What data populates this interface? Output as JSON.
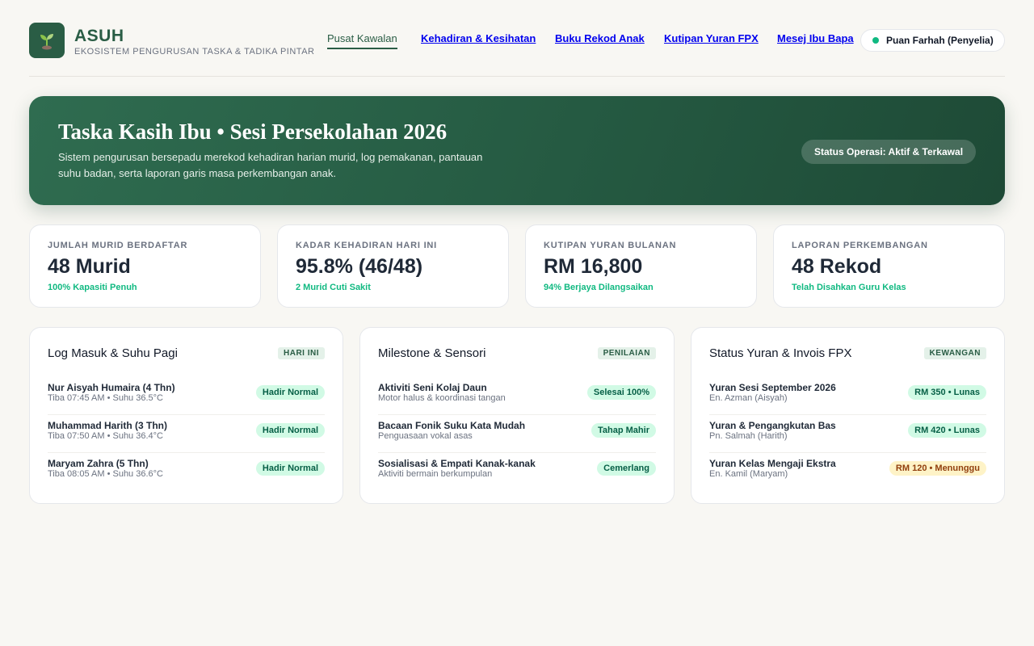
{
  "brand": {
    "name": "ASUH",
    "subtitle": "EKOSISTEM PENGURUSAN TASKA & TADIKA PINTAR",
    "icon": "sprout-icon",
    "color": "#2a5d45"
  },
  "nav": {
    "items": [
      {
        "label": "Pusat Kawalan",
        "active": true
      },
      {
        "label": "Kehadiran & Kesihatan",
        "active": false
      },
      {
        "label": "Buku Rekod Anak",
        "active": false
      },
      {
        "label": "Kutipan Yuran FPX",
        "active": false
      },
      {
        "label": "Mesej Ibu Bapa",
        "active": false
      }
    ]
  },
  "user": {
    "name": "Puan Farhah (Penyelia)",
    "status_color": "#10b981"
  },
  "hero": {
    "title": "Taska Kasih Ibu • Sesi Persekolahan 2026",
    "description": "Sistem pengurusan bersepadu merekod kehadiran harian murid, log pemakanan, pantauan suhu badan, serta laporan garis masa perkembangan anak.",
    "status": "Status Operasi: Aktif & Terkawal"
  },
  "stats": [
    {
      "label": "JUMLAH MURID BERDAFTAR",
      "value": "48 Murid",
      "note": "100% Kapasiti Penuh"
    },
    {
      "label": "KADAR KEHADIRAN HARI INI",
      "value": "95.8% (46/48)",
      "note": "2 Murid Cuti Sakit"
    },
    {
      "label": "KUTIPAN YURAN BULANAN",
      "value": "RM 16,800",
      "note": "94% Berjaya Dilangsaikan"
    },
    {
      "label": "LAPORAN PERKEMBANGAN",
      "value": "48 Rekod",
      "note": "Telah Disahkan Guru Kelas"
    }
  ],
  "panels": [
    {
      "title": "Log Masuk & Suhu Pagi",
      "tag": "HARI INI",
      "rows": [
        {
          "title": "Nur Aisyah Humaira (4 Thn)",
          "sub": "Tiba 07:45 AM • Suhu 36.5°C",
          "badge": "Hadir Normal",
          "status": "ok"
        },
        {
          "title": "Muhammad Harith (3 Thn)",
          "sub": "Tiba 07:50 AM • Suhu 36.4°C",
          "badge": "Hadir Normal",
          "status": "ok"
        },
        {
          "title": "Maryam Zahra (5 Thn)",
          "sub": "Tiba 08:05 AM • Suhu 36.6°C",
          "badge": "Hadir Normal",
          "status": "ok"
        }
      ]
    },
    {
      "title": "Milestone & Sensori",
      "tag": "PENILAIAN",
      "rows": [
        {
          "title": "Aktiviti Seni Kolaj Daun",
          "sub": "Motor halus & koordinasi tangan",
          "badge": "Selesai 100%",
          "status": "ok"
        },
        {
          "title": "Bacaan Fonik Suku Kata Mudah",
          "sub": "Penguasaan vokal asas",
          "badge": "Tahap Mahir",
          "status": "ok"
        },
        {
          "title": "Sosialisasi & Empati Kanak-kanak",
          "sub": "Aktiviti bermain berkumpulan",
          "badge": "Cemerlang",
          "status": "ok"
        }
      ]
    },
    {
      "title": "Status Yuran & Invois FPX",
      "tag": "KEWANGAN",
      "rows": [
        {
          "title": "Yuran Sesi September 2026",
          "sub": "En. Azman (Aisyah)",
          "badge": "RM 350 • Lunas",
          "status": "ok"
        },
        {
          "title": "Yuran & Pengangkutan Bas",
          "sub": "Pn. Salmah (Harith)",
          "badge": "RM 420 • Lunas",
          "status": "ok"
        },
        {
          "title": "Yuran Kelas Mengaji Ekstra",
          "sub": "En. Kamil (Maryam)",
          "badge": "RM 120 • Menunggu",
          "status": "wait"
        }
      ]
    }
  ]
}
